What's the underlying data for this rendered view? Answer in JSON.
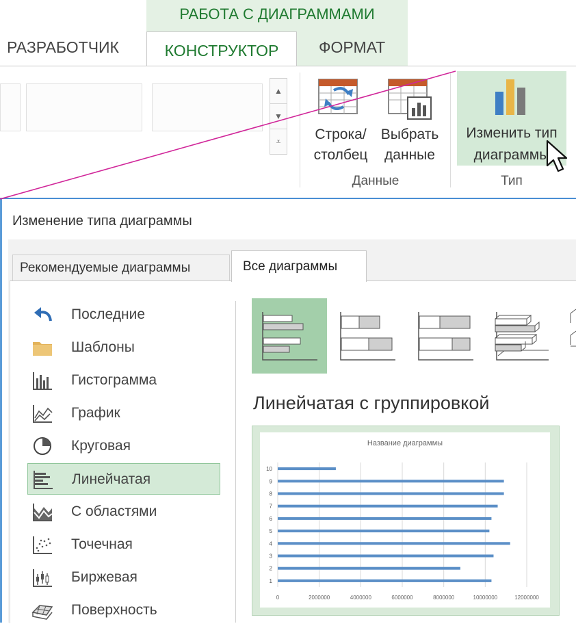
{
  "ribbon": {
    "context_group_title": "РАБОТА С ДИАГРАММАМИ",
    "tabs": [
      {
        "label": "РАЗРАБОТЧИК"
      },
      {
        "label": "КОНСТРУКТОР"
      },
      {
        "label": "ФОРМАТ"
      }
    ],
    "active_tab": "КОНСТРУКТОР",
    "data_group": {
      "label": "Данные",
      "buttons": [
        {
          "label_line1": "Строка/",
          "label_line2": "столбец",
          "icon": "switch-row-column-icon"
        },
        {
          "label_line1": "Выбрать",
          "label_line2": "данные",
          "icon": "select-data-icon"
        }
      ]
    },
    "type_group": {
      "label": "Тип",
      "button": {
        "label_line1": "Изменить тип",
        "label_line2": "диаграммы",
        "icon": "change-chart-type-icon"
      }
    },
    "accent_color": "#1f7a30",
    "highlight_color": "#d4ead7"
  },
  "dialog": {
    "title": "Изменение типа диаграммы",
    "tabs": [
      {
        "label": "Рекомендуемые диаграммы"
      },
      {
        "label": "Все диаграммы"
      }
    ],
    "active_tab": "Все диаграммы",
    "categories": [
      {
        "label": "Последние",
        "icon": "undo-arrow-icon"
      },
      {
        "label": "Шаблоны",
        "icon": "folder-icon"
      },
      {
        "label": "Гистограмма",
        "icon": "column-chart-icon"
      },
      {
        "label": "График",
        "icon": "line-chart-icon"
      },
      {
        "label": "Круговая",
        "icon": "pie-chart-icon"
      },
      {
        "label": "Линейчатая",
        "icon": "bar-chart-icon",
        "selected": true
      },
      {
        "label": "С областями",
        "icon": "area-chart-icon"
      },
      {
        "label": "Точечная",
        "icon": "scatter-chart-icon"
      },
      {
        "label": "Биржевая",
        "icon": "stock-chart-icon"
      },
      {
        "label": "Поверхность",
        "icon": "surface-chart-icon"
      }
    ],
    "preview_title": "Линейчатая с группировкой",
    "selection_color": "#a3cfaa"
  },
  "chart_data": {
    "type": "bar",
    "orientation": "horizontal",
    "title": "Название диаграммы",
    "categories": [
      "1",
      "2",
      "3",
      "4",
      "5",
      "6",
      "7",
      "8",
      "9",
      "10"
    ],
    "values": [
      10300000,
      8800000,
      10400000,
      11200000,
      10200000,
      10300000,
      10600000,
      10900000,
      10900000,
      2800000
    ],
    "x_ticks": [
      "0",
      "2000000",
      "4000000",
      "6000000",
      "8000000",
      "10000000",
      "12000000"
    ],
    "xlim": [
      0,
      12000000
    ],
    "grid": true,
    "series_color": "#5b8fc7"
  }
}
